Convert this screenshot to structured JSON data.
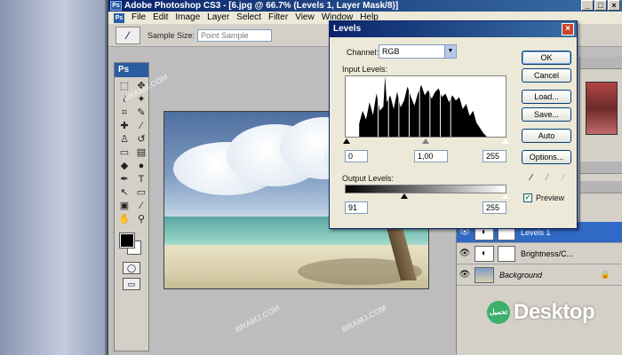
{
  "window": {
    "title": "Adobe Photoshop CS3 - [6.jpg @ 66.7% (Levels 1, Layer Mask/8)]",
    "app_badge": "Ps",
    "minimize": "_",
    "maximize": "□",
    "close": "×"
  },
  "menu": {
    "badge": "Ps",
    "items": [
      "File",
      "Edit",
      "Image",
      "Layer",
      "Select",
      "Filter",
      "View",
      "Window",
      "Help"
    ]
  },
  "options_bar": {
    "sample_size_label": "Sample Size:",
    "sample_size_value": "Point Sample"
  },
  "toolbox": {
    "header": "Ps"
  },
  "levels_dialog": {
    "title": "Levels",
    "close": "×",
    "channel_label": "Channel:",
    "channel_value": "RGB",
    "input_levels_label": "Input Levels:",
    "input_black": "0",
    "input_gamma": "1,00",
    "input_white": "255",
    "output_levels_label": "Output Levels:",
    "output_black": "91",
    "output_white": "255",
    "buttons": {
      "ok": "OK",
      "cancel": "Cancel",
      "load": "Load...",
      "save": "Save...",
      "auto": "Auto",
      "options": "Options..."
    },
    "preview_label": "Preview",
    "preview_checked": true
  },
  "layers": {
    "rows": [
      {
        "name": "Levels 1",
        "selected": true
      },
      {
        "name": "Brightness/C...",
        "selected": false
      },
      {
        "name": "Background",
        "selected": false,
        "italic": true
      }
    ]
  },
  "brand": {
    "circle_text": "تحميل",
    "text": "Desktop"
  },
  "watermark_text": "BRAMJ.COM"
}
